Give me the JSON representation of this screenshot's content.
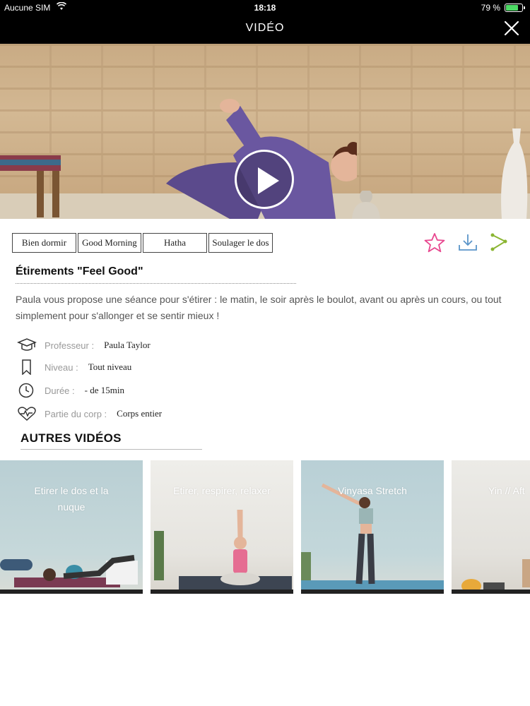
{
  "status": {
    "carrier": "Aucune SIM",
    "time": "18:18",
    "battery": "79 %",
    "battery_level": 0.79
  },
  "nav": {
    "title": "VIDÉO"
  },
  "tags": [
    "Bien dormir",
    "Good Morning",
    "Hatha",
    "Soulager le dos"
  ],
  "video": {
    "title": "Étirements \"Feel Good\"",
    "description": "Paula vous propose une séance pour s'étirer : le matin, le soir après le boulot, avant ou après un cours, ou tout simplement pour s'allonger et se sentir mieux !"
  },
  "meta": {
    "teacher": {
      "label": "Professeur :",
      "value": "Paula Taylor"
    },
    "level": {
      "label": "Niveau :",
      "value": "Tout niveau"
    },
    "duration": {
      "label": "Durée :",
      "value": "- de 15min"
    },
    "body_part": {
      "label": "Partie du corp :",
      "value": "Corps entier"
    }
  },
  "others": {
    "title": "AUTRES VIDÉOS",
    "cards": [
      {
        "label": "Etirer le dos et la nuque"
      },
      {
        "label": "Etirer, respirer, relaxer"
      },
      {
        "label": "Vinyasa Stretch"
      },
      {
        "label": "Yin // Aft"
      }
    ]
  },
  "colors": {
    "favorite": "#e8478f",
    "download": "#5b95c9",
    "share": "#8bb533"
  },
  "icons": [
    "wifi-icon",
    "battery-icon",
    "close-icon",
    "play-icon",
    "star-icon",
    "download-icon",
    "share-icon",
    "graduation-cap-icon",
    "bookmark-icon",
    "clock-icon",
    "heart-pulse-icon"
  ]
}
